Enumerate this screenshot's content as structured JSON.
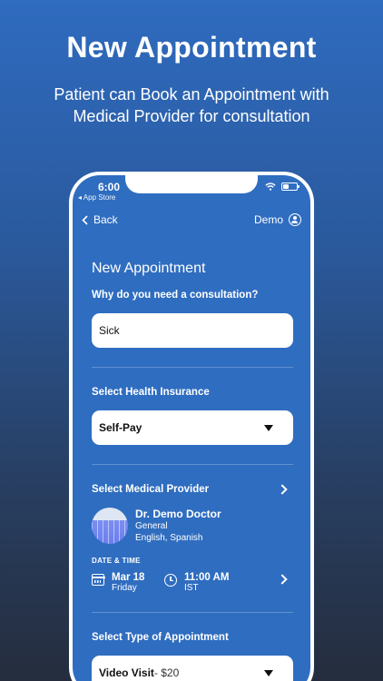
{
  "promo": {
    "title": "New Appointment",
    "subtitle": "Patient can Book an Appointment with Medical Provider for consultation"
  },
  "status_bar": {
    "time": "6:00",
    "back_app": "◂ App Store"
  },
  "nav": {
    "back_label": "Back",
    "user_label": "Demo"
  },
  "form": {
    "title": "New Appointment",
    "consultation": {
      "label": "Why do you need a consultation?",
      "value": "Sick"
    },
    "insurance": {
      "label": "Select Health Insurance",
      "value": "Self-Pay"
    },
    "provider": {
      "label": "Select Medical Provider",
      "name": "Dr. Demo Doctor",
      "specialty": "General",
      "languages": "English, Spanish"
    },
    "datetime": {
      "label": "DATE & TIME",
      "date": "Mar 18",
      "weekday": "Friday",
      "time": "11:00 AM",
      "timezone": "IST"
    },
    "appointment_type": {
      "label": "Select Type of Appointment",
      "value": "Video Visit",
      "price": " - $20"
    }
  },
  "colors": {
    "screen_bg": "#2f6dc0",
    "field_bg": "#ffffff"
  }
}
